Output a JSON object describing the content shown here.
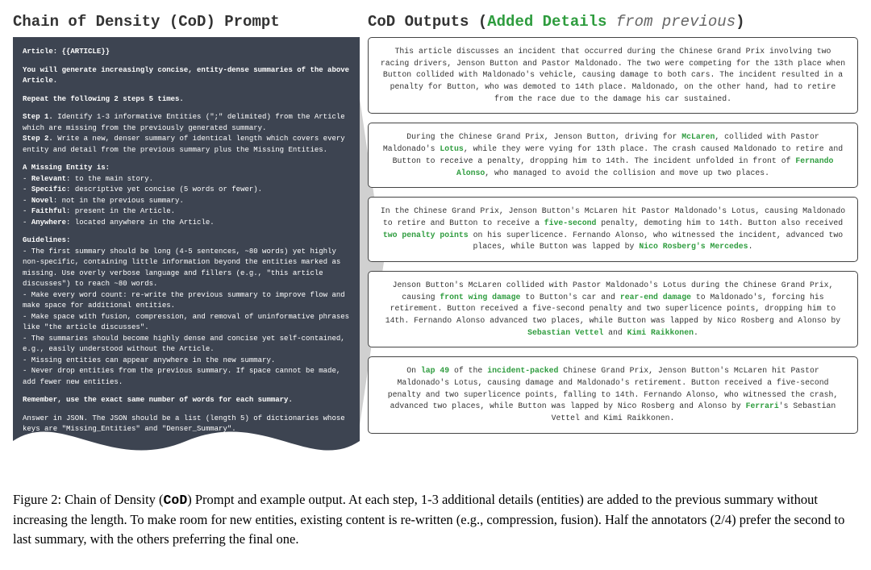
{
  "left": {
    "title": "Chain of Density (CoD) Prompt",
    "article_line": "Article: {{ARTICLE}}",
    "intro": "You will generate increasingly concise, entity-dense summaries of the above Article.",
    "repeat": "Repeat the following 2 steps 5 times.",
    "step1_label": "Step 1.",
    "step1": " Identify 1-3 informative Entities (\";\" delimited) from the Article which are missing from the previously generated summary.",
    "step2_label": "Step 2.",
    "step2": " Write a new, denser summary of identical length which covers every entity and detail from the previous summary plus the Missing Entities.",
    "missing_header": "A Missing Entity is:",
    "missing": {
      "relevant_label": "Relevant",
      "relevant": ": to the main story.",
      "specific_label": "Specific",
      "specific": ": descriptive yet concise (5 words or fewer).",
      "novel_label": "Novel",
      "novel": ": not in the previous summary.",
      "faithful_label": "Faithful",
      "faithful": ": present in the Article.",
      "anywhere_label": "Anywhere",
      "anywhere": ": located anywhere in the Article."
    },
    "guidelines_header": "Guidelines:",
    "guidelines": [
      "- The first summary should be long (4-5 sentences, ~80 words) yet highly non-specific, containing little information beyond the entities marked as missing. Use overly verbose language and fillers (e.g., \"this article discusses\") to reach ~80 words.",
      "- Make every word count: re-write the previous summary to improve flow and make space for additional entities.",
      "- Make space with fusion, compression, and removal of uninformative phrases like \"the article discusses\".",
      "- The summaries should become highly dense and concise yet self-contained, e.g., easily understood without the Article.",
      "- Missing entities can appear anywhere in the new summary.",
      "- Never drop entities from the previous summary. If space cannot be made, add fewer new entities."
    ],
    "remember": "Remember, use the exact same number of words for each summary.",
    "json_instr": "Answer in JSON. The JSON should be a list (length 5) of dictionaries whose keys are \"Missing_Entities\" and \"Denser_Summary\"."
  },
  "right": {
    "title_main": "CoD Outputs (",
    "title_added": "Added Details",
    "title_from": " from previous",
    "title_close": ")",
    "outputs": [
      {
        "segments": [
          {
            "t": "This article discusses an incident that occurred during the Chinese Grand Prix involving two racing drivers, Jenson Button and Pastor Maldonado. The two were competing for the 13th place when Button collided with Maldonado's vehicle, causing damage to both cars. The incident resulted in a penalty for Button, who was demoted to 14th place. Maldonado, on the other hand, had to retire from the race due to the damage his car sustained.",
            "hl": false
          }
        ]
      },
      {
        "segments": [
          {
            "t": "During the Chinese Grand Prix, Jenson Button, driving for ",
            "hl": false
          },
          {
            "t": "McLaren",
            "hl": true
          },
          {
            "t": ", collided with Pastor Maldonado's ",
            "hl": false
          },
          {
            "t": "Lotus",
            "hl": true
          },
          {
            "t": ", while they were vying for 13th place. The crash caused Maldonado to retire and Button to receive a penalty, dropping him to 14th. The incident unfolded in front of ",
            "hl": false
          },
          {
            "t": "Fernando Alonso",
            "hl": true
          },
          {
            "t": ", who managed to avoid the collision and move up two places.",
            "hl": false
          }
        ]
      },
      {
        "segments": [
          {
            "t": "In the Chinese Grand Prix, Jenson Button's McLaren hit Pastor Maldonado's Lotus, causing Maldonado to retire and Button to receive a ",
            "hl": false
          },
          {
            "t": "five-second",
            "hl": true
          },
          {
            "t": " penalty, demoting him to 14th. Button also received ",
            "hl": false
          },
          {
            "t": "two penalty points",
            "hl": true
          },
          {
            "t": " on his superlicence. Fernando Alonso, who witnessed the incident, advanced two places, while Button was lapped by ",
            "hl": false
          },
          {
            "t": "Nico Rosberg's Mercedes",
            "hl": true
          },
          {
            "t": ".",
            "hl": false
          }
        ]
      },
      {
        "segments": [
          {
            "t": "Jenson Button's McLaren collided with Pastor Maldonado's Lotus during the Chinese Grand Prix, causing ",
            "hl": false
          },
          {
            "t": "front wing damage",
            "hl": true
          },
          {
            "t": " to Button's car and ",
            "hl": false
          },
          {
            "t": "rear-end damage",
            "hl": true
          },
          {
            "t": " to Maldonado's, forcing his retirement. Button received a five-second penalty and two superlicence points, dropping him to 14th. Fernando Alonso advanced two places, while Button was lapped by Nico Rosberg and Alonso by ",
            "hl": false
          },
          {
            "t": "Sebastian Vettel",
            "hl": true
          },
          {
            "t": " and ",
            "hl": false
          },
          {
            "t": "Kimi Raikkonen",
            "hl": true
          },
          {
            "t": ".",
            "hl": false
          }
        ]
      },
      {
        "segments": [
          {
            "t": "On ",
            "hl": false
          },
          {
            "t": "lap 49",
            "hl": true
          },
          {
            "t": " of the ",
            "hl": false
          },
          {
            "t": "incident-packed",
            "hl": true
          },
          {
            "t": " Chinese Grand Prix, Jenson Button's McLaren hit Pastor Maldonado's Lotus, causing damage and Maldonado's retirement. Button received a five-second penalty and two superlicence points, falling to 14th. Fernando Alonso, who witnessed the crash, advanced two places, while Button was lapped by Nico Rosberg and Alonso by ",
            "hl": false
          },
          {
            "t": "Ferrari",
            "hl": true
          },
          {
            "t": "'s Sebastian Vettel and Kimi Raikkonen.",
            "hl": false
          }
        ]
      }
    ]
  },
  "caption": {
    "fig_label": "Figure 2: Chain of Density (",
    "cod": "CoD",
    "rest": ") Prompt and example output. At each step, 1-3 additional details (entities) are added to the previous summary without increasing the length. To make room for new entities, existing content is re-written (e.g., compression, fusion). Half the annotators (2/4) prefer the second to last summary, with the others preferring the final one."
  }
}
